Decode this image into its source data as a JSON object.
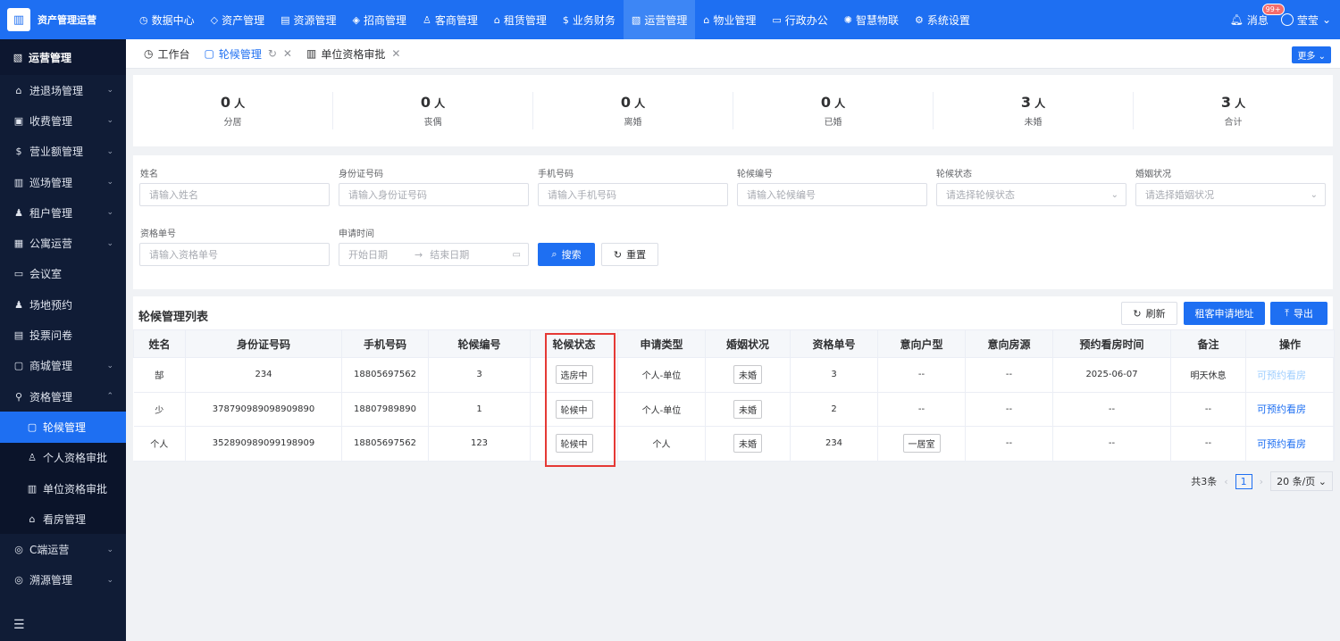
{
  "app": {
    "logo_text": "资产管理运营",
    "logo_icon": "building-icon"
  },
  "topnav": [
    {
      "label": "数据中心",
      "icon": "clock-icon",
      "active": false
    },
    {
      "label": "资产管理",
      "icon": "cube-icon",
      "active": false
    },
    {
      "label": "资源管理",
      "icon": "doc-icon",
      "active": false
    },
    {
      "label": "招商管理",
      "icon": "tag-icon",
      "active": false
    },
    {
      "label": "客商管理",
      "icon": "people-icon",
      "active": false
    },
    {
      "label": "租赁管理",
      "icon": "house-icon",
      "active": false
    },
    {
      "label": "业务财务",
      "icon": "money-icon",
      "active": false
    },
    {
      "label": "运营管理",
      "icon": "chart-icon",
      "active": true
    },
    {
      "label": "物业管理",
      "icon": "home-icon",
      "active": false
    },
    {
      "label": "行政办公",
      "icon": "monitor-icon",
      "active": false
    },
    {
      "label": "智慧物联",
      "icon": "sun-icon",
      "active": false
    },
    {
      "label": "系统设置",
      "icon": "gear-icon",
      "active": false
    }
  ],
  "header_right": {
    "message_label": "消息",
    "badge": "99+",
    "user_name": "莹莹"
  },
  "sidebar": {
    "title": "运营管理",
    "items": [
      {
        "label": "进退场管理",
        "arrow": "⌄"
      },
      {
        "label": "收费管理",
        "arrow": "⌄"
      },
      {
        "label": "营业额管理",
        "arrow": "⌄"
      },
      {
        "label": "巡场管理",
        "arrow": "⌄"
      },
      {
        "label": "租户管理",
        "arrow": "⌄"
      },
      {
        "label": "公寓运营",
        "arrow": "⌄"
      },
      {
        "label": "会议室",
        "arrow": ""
      },
      {
        "label": "场地预约",
        "arrow": ""
      },
      {
        "label": "投票问卷",
        "arrow": ""
      },
      {
        "label": "商城管理",
        "arrow": "⌄"
      },
      {
        "label": "资格管理",
        "arrow": "⌃"
      }
    ],
    "sub_items": [
      {
        "label": "轮候管理",
        "active": true
      },
      {
        "label": "个人资格审批",
        "active": false
      },
      {
        "label": "单位资格审批",
        "active": false
      },
      {
        "label": "看房管理",
        "active": false
      }
    ],
    "tail_items": [
      {
        "label": "C端运营",
        "arrow": "⌄"
      },
      {
        "label": "溯源管理",
        "arrow": "⌄"
      }
    ]
  },
  "tabs": [
    {
      "label": "工作台",
      "active": false,
      "closable": false
    },
    {
      "label": "轮候管理",
      "active": true,
      "closable": true
    },
    {
      "label": "单位资格审批",
      "active": false,
      "closable": true
    }
  ],
  "more_label": "更多",
  "stats": [
    {
      "value": "0",
      "unit": "人",
      "label": "分居"
    },
    {
      "value": "0",
      "unit": "人",
      "label": "丧偶"
    },
    {
      "value": "0",
      "unit": "人",
      "label": "离婚"
    },
    {
      "value": "0",
      "unit": "人",
      "label": "已婚"
    },
    {
      "value": "3",
      "unit": "人",
      "label": "未婚"
    },
    {
      "value": "3",
      "unit": "人",
      "label": "合计"
    }
  ],
  "filter": {
    "name_label": "姓名",
    "name_placeholder": "请输入姓名",
    "id_label": "身份证号码",
    "id_placeholder": "请输入身份证号码",
    "phone_label": "手机号码",
    "phone_placeholder": "请输入手机号码",
    "queue_no_label": "轮候编号",
    "queue_no_placeholder": "请输入轮候编号",
    "queue_status_label": "轮候状态",
    "queue_status_placeholder": "请选择轮候状态",
    "marital_label": "婚姻状况",
    "marital_placeholder": "请选择婚姻状况",
    "qual_no_label": "资格单号",
    "qual_no_placeholder": "请输入资格单号",
    "apply_time_label": "申请时间",
    "start_placeholder": "开始日期",
    "end_placeholder": "结束日期",
    "search_label": "搜索",
    "reset_label": "重置"
  },
  "list": {
    "title": "轮候管理列表",
    "refresh_label": "刷新",
    "address_label": "租客申请地址",
    "export_label": "导出",
    "columns": [
      "姓名",
      "身份证号码",
      "手机号码",
      "轮候编号",
      "轮候状态",
      "申请类型",
      "婚姻状况",
      "资格单号",
      "意向户型",
      "意向房源",
      "预约看房时间",
      "备注",
      "操作"
    ],
    "rows": [
      {
        "name": "郜",
        "id_no": "234",
        "phone": "18805697562",
        "queue_no": "3",
        "status": "选房中",
        "apply_type": "个人-单位",
        "marital": "未婚",
        "qual_no": "3",
        "layout": "--",
        "house": "--",
        "visit_time": "2025-06-07",
        "remark": "明天休息",
        "action": "可预约看房",
        "action_enabled": false
      },
      {
        "name": "少",
        "id_no": "378790989098909890",
        "phone": "18807989890",
        "queue_no": "1",
        "status": "轮候中",
        "apply_type": "个人-单位",
        "marital": "未婚",
        "qual_no": "2",
        "layout": "--",
        "house": "--",
        "visit_time": "--",
        "remark": "--",
        "action": "可预约看房",
        "action_enabled": true
      },
      {
        "name": "个人",
        "id_no": "352890989099198909",
        "phone": "18805697562",
        "queue_no": "123",
        "status": "轮候中",
        "apply_type": "个人",
        "marital": "未婚",
        "qual_no": "234",
        "layout": "一居室",
        "house": "--",
        "visit_time": "--",
        "remark": "--",
        "action": "可预约看房",
        "action_enabled": true
      }
    ]
  },
  "pagination": {
    "total_text": "共3条",
    "current_page": "1",
    "page_size": "20 条/页"
  },
  "colors": {
    "primary": "#1e6ff2",
    "sidebar_bg": "#101c36",
    "highlight": "#e53935"
  }
}
